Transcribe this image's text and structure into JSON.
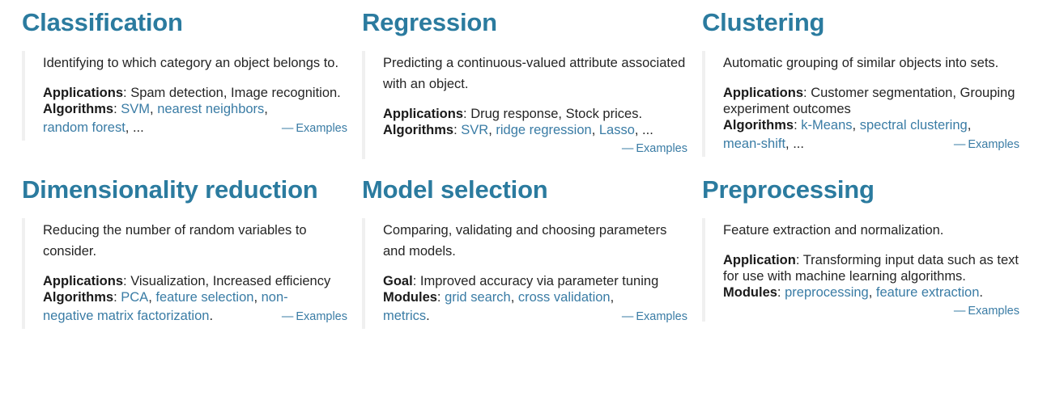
{
  "page": {
    "title": "scikit-learn feature grid",
    "accent_heading_color": "#2b7b9f",
    "link_color": "#3a7ca5",
    "border_color": "#f0f0f0",
    "text_color": "#252525",
    "background": "#ffffff"
  },
  "examples_label": "Examples",
  "examples_dash": "—",
  "cards": [
    {
      "title": "Classification",
      "description": "Identifying to which category an object belongs to.",
      "detail_rows": [
        {
          "label": "Applications",
          "sep": ": ",
          "plain": "Spam detection, Image recognition."
        },
        {
          "label": "Algorithms",
          "sep": ": ",
          "links_prefix": [
            "SVM",
            "nearest neighbors"
          ],
          "wrapped_links": [
            "random forest"
          ],
          "tail": ", ..."
        }
      ],
      "algorithms_line_1": "SVM, nearest neighbors,",
      "algorithms_line_2_link": "random forest",
      "algorithms_line_2_tail": ", ...",
      "examples_inline": true
    },
    {
      "title": "Regression",
      "description": "Predicting a continuous-valued attribute associated with an object.",
      "detail_rows": [
        {
          "label": "Applications",
          "sep": ": ",
          "plain": "Drug response, Stock prices."
        },
        {
          "label": "Algorithms",
          "sep": ": ",
          "links": [
            "SVR",
            "ridge regression",
            "Lasso"
          ],
          "tail": ", ..."
        }
      ],
      "algorithms_links": [
        "SVR",
        "ridge regression",
        "Lasso"
      ],
      "algorithms_tail": ", ...",
      "examples_inline": false
    },
    {
      "title": "Clustering",
      "description": "Automatic grouping of similar objects into sets.",
      "detail_rows": [
        {
          "label": "Applications",
          "sep": ": ",
          "plain": "Customer segmentation, Grouping experiment outcomes"
        },
        {
          "label": "Algorithms",
          "sep": ": ",
          "links": [
            "k-Means",
            "spectral clustering",
            "mean-shift"
          ],
          "tail": ", ..."
        }
      ],
      "algorithms_line_1_links": [
        "k-Means",
        "spectral clustering"
      ],
      "algorithms_line_2_link": "mean-shift",
      "algorithms_line_2_tail": ", ...",
      "examples_inline": true
    },
    {
      "title": "Dimensionality reduction",
      "description": "Reducing the number of random variables to consider.",
      "detail_rows": [
        {
          "label": "Applications",
          "sep": ": ",
          "plain": "Visualization, Increased efficiency"
        },
        {
          "label": "Algorithms",
          "sep": ": ",
          "links": [
            "PCA",
            "feature selection",
            "non-negative matrix factorization"
          ],
          "tail": "."
        }
      ],
      "algorithms_line_1_links": [
        "PCA",
        "feature selection"
      ],
      "algorithms_line_1_partial": "non-",
      "algorithms_line_2_link": "negative matrix factorization",
      "algorithms_line_2_tail": ".",
      "examples_inline": true
    },
    {
      "title": "Model selection",
      "description": "Comparing, validating and choosing parameters and models.",
      "detail_rows": [
        {
          "label": "Goal",
          "sep": ": ",
          "plain": "Improved accuracy via parameter tuning"
        },
        {
          "label": "Modules",
          "sep": ": ",
          "links": [
            "grid search",
            "cross validation",
            "metrics"
          ],
          "tail": "."
        }
      ],
      "modules_line_1_links": [
        "grid search",
        "cross validation"
      ],
      "modules_line_2_link": "metrics",
      "modules_line_2_tail": ".",
      "examples_inline": true
    },
    {
      "title": "Preprocessing",
      "description": "Feature extraction and normalization.",
      "detail_rows": [
        {
          "label": "Application",
          "sep": ": ",
          "plain": "Transforming input data such as text for use with machine learning algorithms."
        },
        {
          "label": "Modules",
          "sep": ": ",
          "links": [
            "preprocessing",
            "feature extraction"
          ],
          "tail": "."
        }
      ],
      "modules_links": [
        "preprocessing",
        "feature extraction"
      ],
      "modules_tail": ".",
      "examples_inline": false
    }
  ]
}
